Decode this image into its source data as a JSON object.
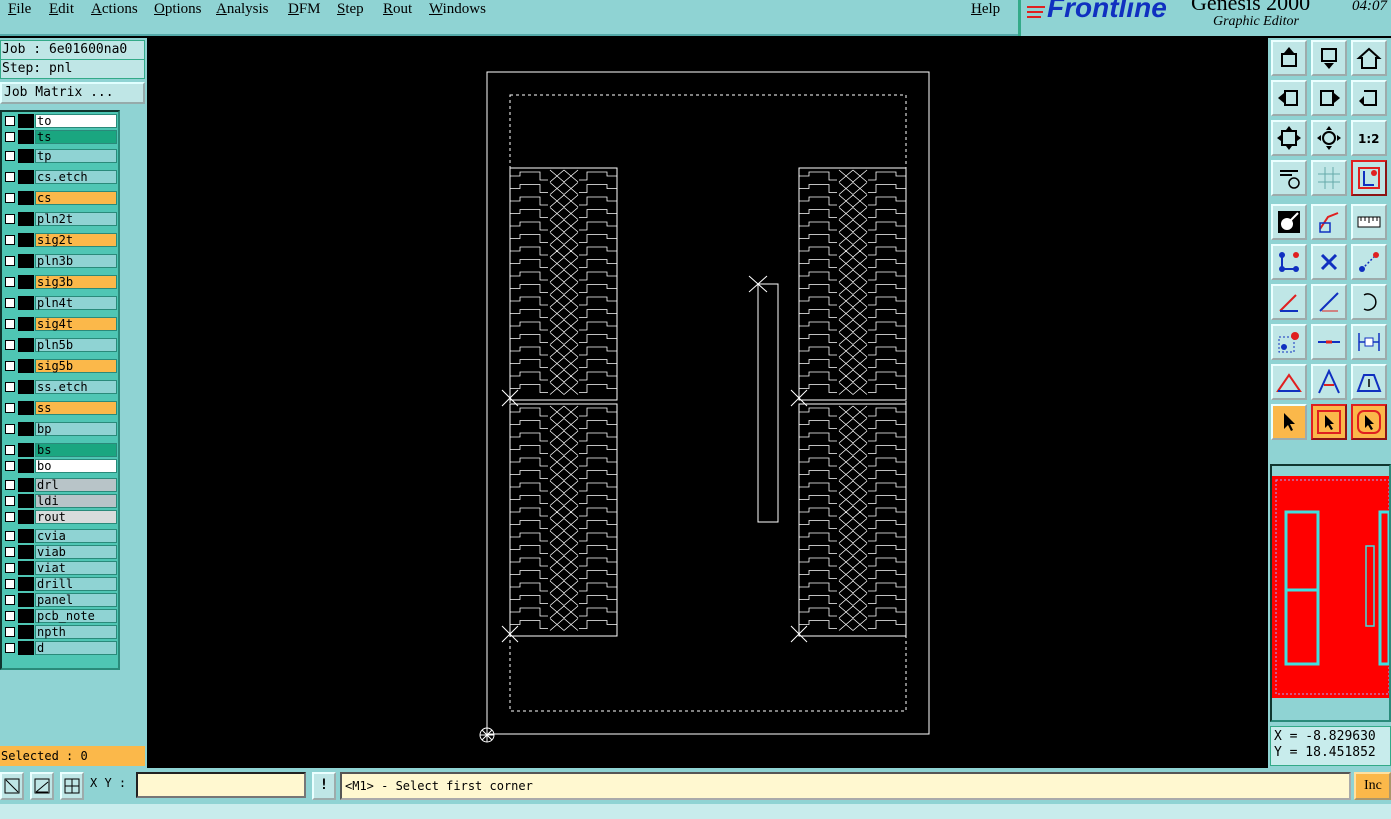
{
  "menubar": {
    "file": "File",
    "edit": "Edit",
    "actions": "Actions",
    "options": "Options",
    "analysis": "Analysis",
    "dfm": "DFM",
    "step": "Step",
    "rout": "Rout",
    "windows": "Windows",
    "help": "Help"
  },
  "brand": {
    "logo": "Frontline",
    "product": "Genesis 2000",
    "subtitle": "Graphic Editor",
    "clock": "04:07"
  },
  "job": {
    "job_label": "Job : 6e01600na0",
    "step_label": "Step: pnl",
    "matrix_button": "Job Matrix ..."
  },
  "layers": [
    {
      "name": "to",
      "color": "#ffffff"
    },
    {
      "name": "ts",
      "color": "#1aa680"
    },
    {
      "name": "tp",
      "color": "#8fd3d3"
    },
    {
      "name": "cs.etch",
      "color": "#8fd3d3"
    },
    {
      "name": "cs",
      "color": "#fbb84a"
    },
    {
      "name": "pln2t",
      "color": "#8fd3d3"
    },
    {
      "name": "sig2t",
      "color": "#fbb84a"
    },
    {
      "name": "pln3b",
      "color": "#8fd3d3"
    },
    {
      "name": "sig3b",
      "color": "#fbb84a"
    },
    {
      "name": "pln4t",
      "color": "#8fd3d3"
    },
    {
      "name": "sig4t",
      "color": "#fbb84a"
    },
    {
      "name": "pln5b",
      "color": "#8fd3d3"
    },
    {
      "name": "sig5b",
      "color": "#fbb84a"
    },
    {
      "name": "ss.etch",
      "color": "#8fd3d3"
    },
    {
      "name": "ss",
      "color": "#fbb84a"
    },
    {
      "name": "bp",
      "color": "#8fd3d3"
    },
    {
      "name": "bs",
      "color": "#1aa680"
    },
    {
      "name": "bo",
      "color": "#ffffff"
    },
    {
      "name": "drl",
      "color": "#b8c4c8"
    },
    {
      "name": "ldi",
      "color": "#b8c4c8"
    },
    {
      "name": "rout",
      "color": "#d8dcdc"
    },
    {
      "name": "cvia",
      "color": "#8fd3d3"
    },
    {
      "name": "viab",
      "color": "#8fd3d3"
    },
    {
      "name": "viat",
      "color": "#8fd3d3"
    },
    {
      "name": "drill",
      "color": "#8fd3d3"
    },
    {
      "name": "panel",
      "color": "#8fd3d3"
    },
    {
      "name": "pcb_note",
      "color": "#8fd3d3"
    },
    {
      "name": "npth",
      "color": "#8fd3d3"
    },
    {
      "name": "d",
      "color": "#8fd3d3"
    }
  ],
  "status": {
    "selected": "Selected : 0"
  },
  "coords": {
    "x": "X = -8.829630",
    "y": "Y = 18.451852"
  },
  "bottom": {
    "xy_label": "X Y :",
    "xy_value": "",
    "bang": "!",
    "prompt": "<M1> - Select first corner",
    "inc": "Inc"
  },
  "colors": {
    "panel_bg": "#8fd3d3",
    "accent_orange": "#fbb84a",
    "minimap_bg": "#ff0000",
    "graphics": "#ffffff"
  }
}
